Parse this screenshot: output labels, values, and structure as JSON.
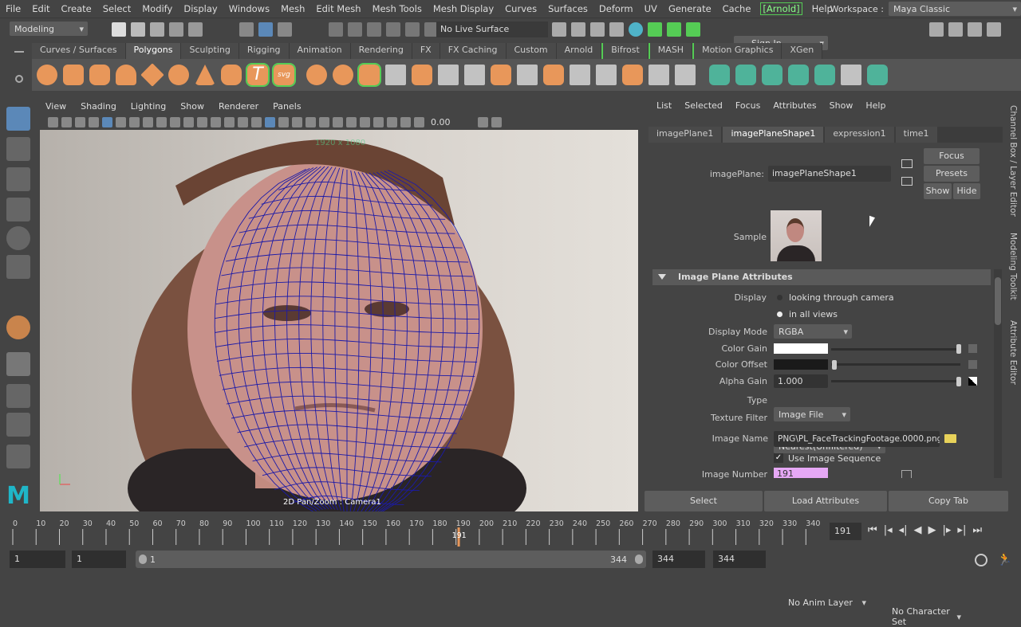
{
  "menubar": {
    "items": [
      "File",
      "Edit",
      "Create",
      "Select",
      "Modify",
      "Display",
      "Windows",
      "Mesh",
      "Edit Mesh",
      "Mesh Tools",
      "Mesh Display",
      "Curves",
      "Surfaces",
      "Deform",
      "UV",
      "Generate",
      "Cache",
      "[Arnold]",
      "Help"
    ],
    "workspace_label": "Workspace :",
    "workspace_value": "Maya Classic"
  },
  "status": {
    "mode": "Modeling",
    "live_surface": "No Live Surface",
    "sign_in": "Sign In"
  },
  "shelf": {
    "tabs": [
      "Curves / Surfaces",
      "Polygons",
      "Sculpting",
      "Rigging",
      "Animation",
      "Rendering",
      "FX",
      "FX Caching",
      "Custom",
      "Arnold",
      "Bifrost",
      "MASH",
      "Motion Graphics",
      "XGen"
    ],
    "active": "Polygons"
  },
  "viewport": {
    "menu": [
      "View",
      "Shading",
      "Lighting",
      "Show",
      "Renderer",
      "Panels"
    ],
    "exposure": "0.00",
    "resolution": "1920 x 1080",
    "camera_label": "2D Pan/Zoom : Camera1"
  },
  "attr": {
    "menu": [
      "List",
      "Selected",
      "Focus",
      "Attributes",
      "Show",
      "Help"
    ],
    "tabs": [
      "imagePlane1",
      "imagePlaneShape1",
      "expression1",
      "time1"
    ],
    "active_tab": "imagePlaneShape1",
    "node_label": "imagePlane:",
    "node_value": "imagePlaneShape1",
    "focus": "Focus",
    "presets": "Presets",
    "show": "Show",
    "hide": "Hide",
    "sample_label": "Sample",
    "section": "Image Plane Attributes",
    "display_label": "Display",
    "display_opt1": "looking through camera",
    "display_opt2": "in all views",
    "display_selected": "in all views",
    "display_mode_label": "Display Mode",
    "display_mode": "RGBA",
    "color_gain_label": "Color Gain",
    "color_gain": "#ffffff",
    "color_offset_label": "Color Offset",
    "color_offset": "#1a1a1a",
    "alpha_gain_label": "Alpha Gain",
    "alpha_gain": "1.000",
    "type_label": "Type",
    "type": "Image File",
    "texture_filter_label": "Texture Filter",
    "texture_filter": "Nearest(Unfiltered)",
    "image_name_label": "Image Name",
    "image_name": "PNG\\PL_FaceTrackingFootage.0000.png",
    "use_seq": "Use Image Sequence",
    "use_seq_checked": true,
    "image_number_label": "Image Number",
    "image_number": "191",
    "select": "Select",
    "load": "Load Attributes",
    "copy": "Copy Tab"
  },
  "sidetabs": [
    "Channel Box / Layer Editor",
    "Modeling Toolkit",
    "Attribute Editor"
  ],
  "timeline": {
    "ticks": [
      0,
      10,
      20,
      30,
      40,
      50,
      60,
      70,
      80,
      90,
      100,
      110,
      120,
      130,
      140,
      150,
      160,
      170,
      180,
      190,
      200,
      210,
      220,
      230,
      240,
      250,
      260,
      270,
      280,
      290,
      300,
      310,
      320,
      330,
      340
    ],
    "current": "191",
    "current_frame_field": "191",
    "max": 344
  },
  "range": {
    "start": "1",
    "playback_start": "1",
    "slider_start": "1",
    "slider_end": "344",
    "playback_end": "344",
    "end": "344",
    "anim_layer": "No Anim Layer",
    "character_set": "No Character Set"
  }
}
